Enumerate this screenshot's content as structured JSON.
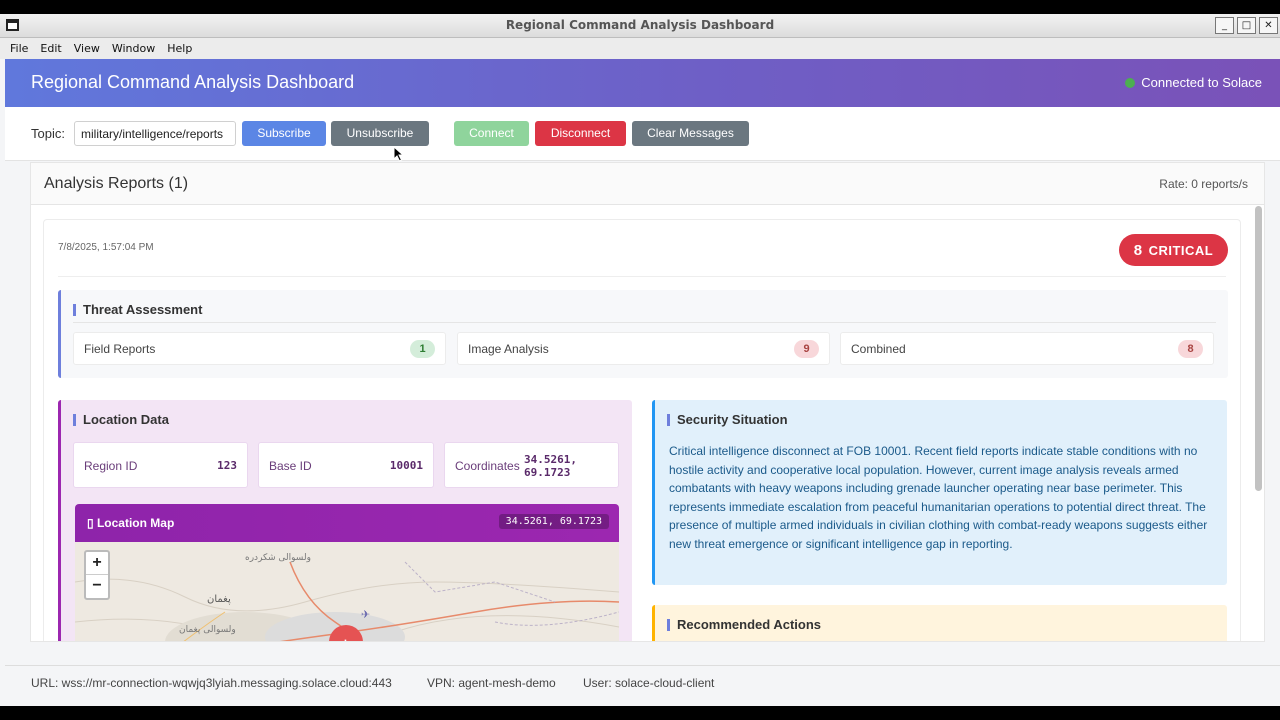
{
  "window": {
    "title": "Regional Command Analysis Dashboard"
  },
  "menu": [
    "File",
    "Edit",
    "View",
    "Window",
    "Help"
  ],
  "header": {
    "title": "Regional Command Analysis Dashboard",
    "status": "Connected to Solace",
    "status_color": "#4caf50"
  },
  "controls": {
    "topic_label": "Topic:",
    "topic_value": "military/intelligence/reports",
    "subscribe": "Subscribe",
    "unsubscribe": "Unsubscribe",
    "connect": "Connect",
    "disconnect": "Disconnect",
    "clear": "Clear Messages"
  },
  "reports": {
    "title": "Analysis Reports (1)",
    "rate": "Rate: 0 reports/s",
    "card": {
      "timestamp": "7/8/2025, 1:57:04 PM",
      "badge_num": "8",
      "badge_label": "CRITICAL",
      "threat": {
        "title": "Threat Assessment",
        "items": [
          {
            "label": "Field Reports",
            "value": "1"
          },
          {
            "label": "Image Analysis",
            "value": "9"
          },
          {
            "label": "Combined",
            "value": "8"
          }
        ]
      },
      "location": {
        "title": "Location Data",
        "region_label": "Region ID",
        "region_value": "123",
        "base_label": "Base ID",
        "base_value": "10001",
        "coords_label": "Coordinates",
        "coords_lat": "34.5261,",
        "coords_lon": "69.1723",
        "map_title": "Location Map",
        "map_coords": "34.5261, 69.1723",
        "map_labels": [
          "ولسوالی شکردره",
          "پغمان",
          "ولسوالی پغمان"
        ]
      },
      "security": {
        "title": "Security Situation",
        "text": "Critical intelligence disconnect at FOB 10001. Recent field reports indicate stable conditions with no hostile activity and cooperative local population. However, current image analysis reveals armed combatants with heavy weapons including grenade launcher operating near base perimeter. This represents immediate escalation from peaceful humanitarian operations to potential direct threat. The presence of multiple armed individuals in civilian clothing with combat-ready weapons suggests either new threat emergence or significant intelligence gap in reporting."
      },
      "recommended": {
        "title": "Recommended Actions"
      }
    }
  },
  "footer": {
    "url": "URL: wss://mr-connection-wqwjq3lyiah.messaging.solace.cloud:443",
    "vpn": "VPN: agent-mesh-demo",
    "user": "User: solace-cloud-client"
  }
}
